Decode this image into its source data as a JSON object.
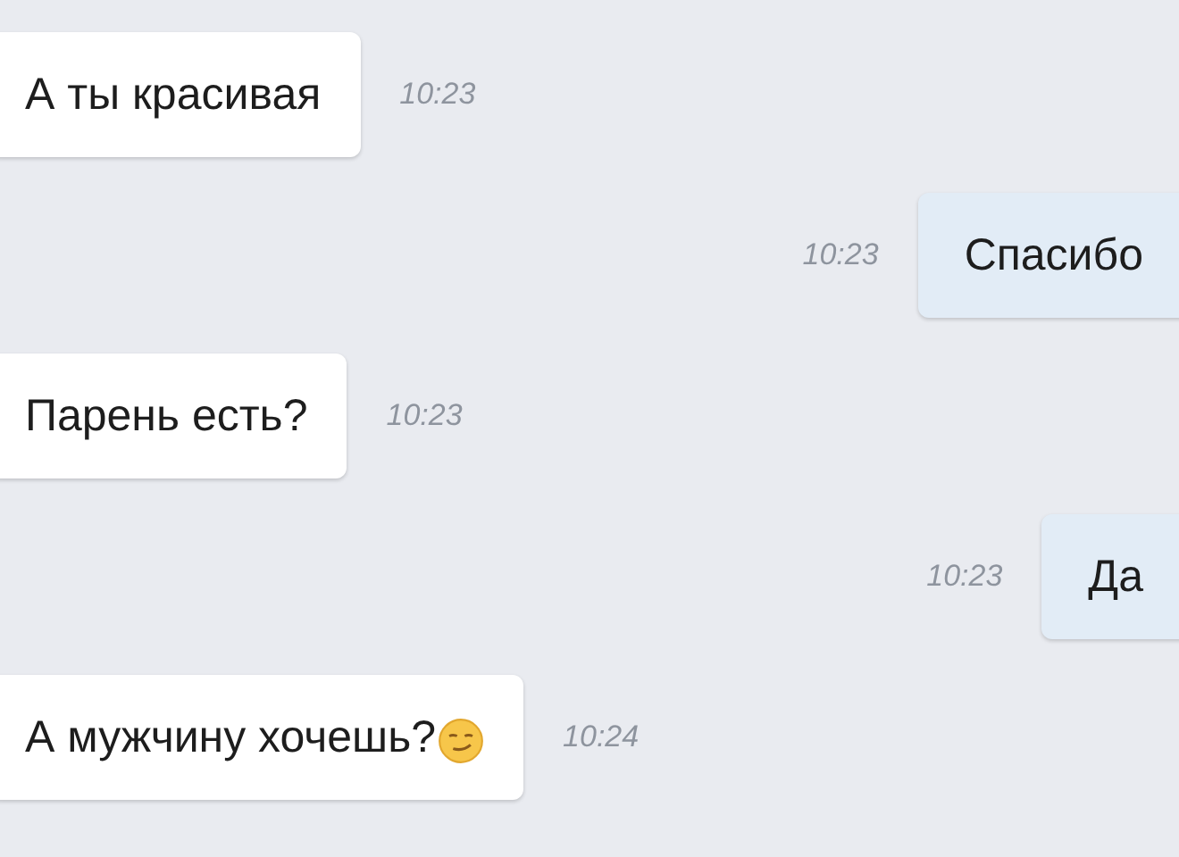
{
  "messages": [
    {
      "kind": "incoming",
      "text": "А ты красивая",
      "time": "10:23",
      "emoji": false
    },
    {
      "kind": "outgoing",
      "text": "Спасибо",
      "time": "10:23",
      "emoji": false
    },
    {
      "kind": "incoming",
      "text": "Парень есть?",
      "time": "10:23",
      "emoji": false
    },
    {
      "kind": "outgoing",
      "text": "Да",
      "time": "10:23",
      "emoji": false
    },
    {
      "kind": "incoming",
      "text": "А мужчину хочешь?",
      "time": "10:24",
      "emoji": true
    }
  ]
}
